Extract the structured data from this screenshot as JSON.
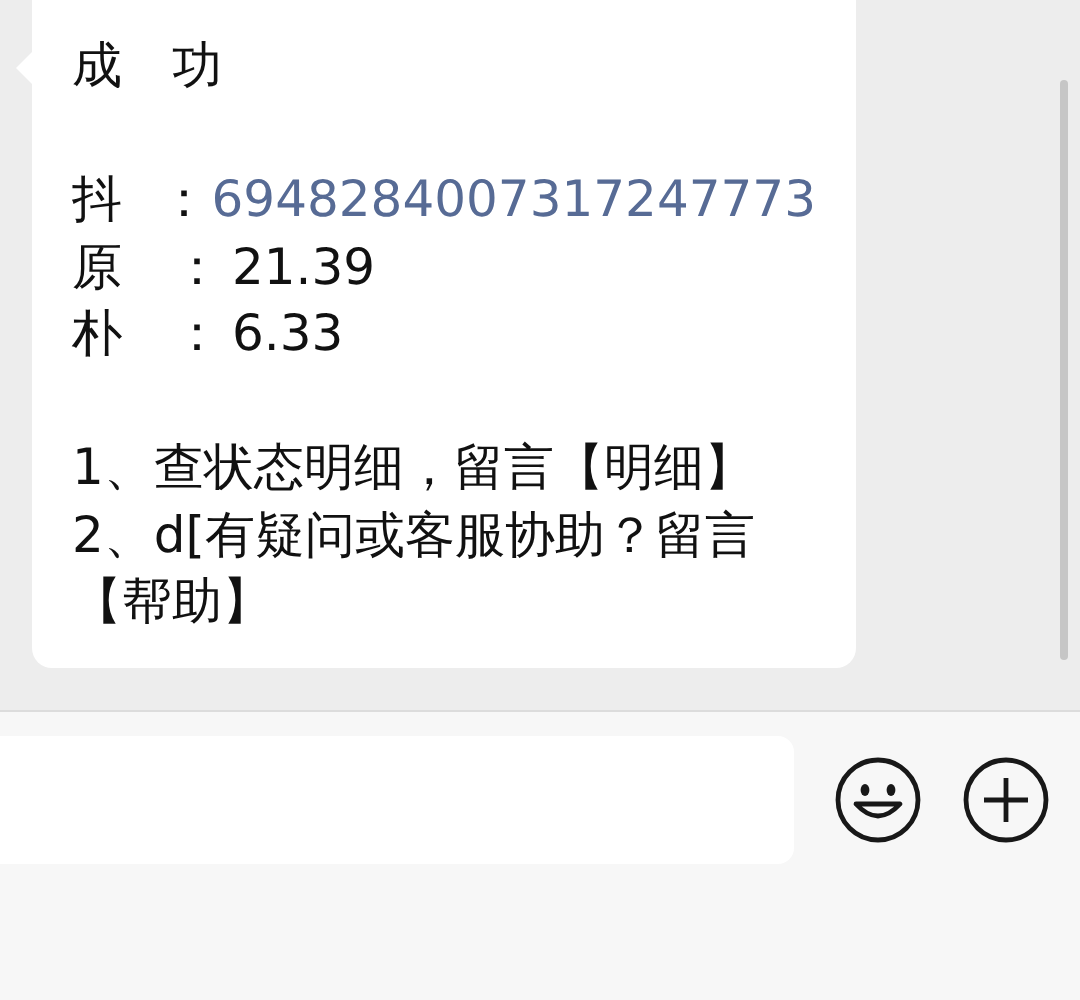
{
  "message": {
    "title": "成　功",
    "fields": [
      {
        "label": "抖",
        "separator": "：",
        "value": "6948284007317247773",
        "kind": "link"
      },
      {
        "label": "原",
        "separator": "：",
        "value": "21.39",
        "kind": "plain"
      },
      {
        "label": "朴",
        "separator": "：",
        "value": "6.33",
        "kind": "plain"
      }
    ],
    "instructions": [
      "1、查状态明细，留言【明细】",
      "2、d[有疑问或客服协助？留言【帮助】"
    ]
  }
}
